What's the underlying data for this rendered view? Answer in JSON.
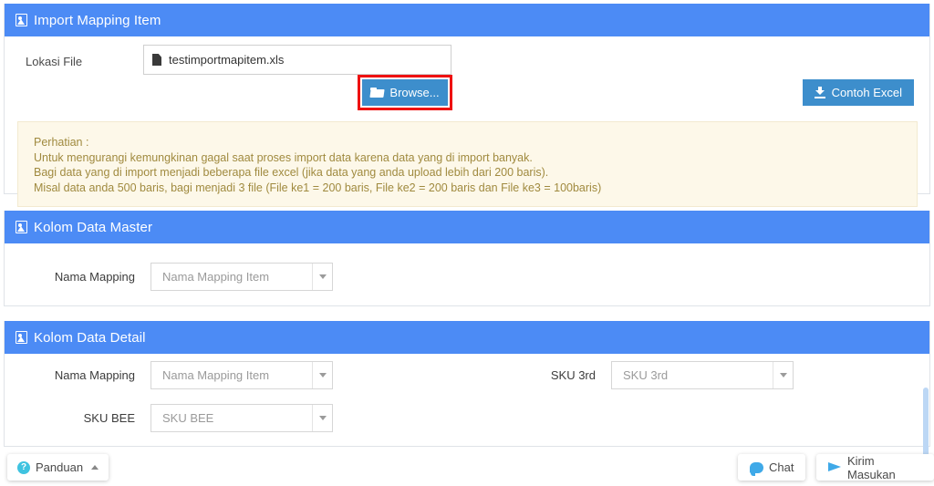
{
  "colors": {
    "header_blue": "#4c8bf5",
    "button_blue": "#3d8ecc",
    "warning_bg": "#fdf8e9",
    "warning_text": "#a08a3f",
    "highlight_red": "#ee1111",
    "accent_cyan": "#3fc3e0"
  },
  "import_section": {
    "title": "Import Mapping Item",
    "icon": "broken-image-icon",
    "file_label": "Lokasi File",
    "file_name": "testimportmapitem.xls",
    "file_icon": "document-icon",
    "browse_label": "Browse...",
    "browse_icon": "folder-icon",
    "contoh_label": "Contoh Excel",
    "contoh_icon": "download-icon",
    "warning": {
      "heading": "Perhatian :",
      "lines": [
        "Untuk mengurangi kemungkinan gagal saat proses import data karena data yang di import banyak.",
        "Bagi data yang di import menjadi beberapa file excel (jika data yang anda upload lebih dari 200 baris).",
        "Misal data anda 500 baris, bagi menjadi 3 file (File ke1 = 200 baris, File ke2 = 200 baris dan File ke3 = 100baris)"
      ]
    }
  },
  "master_section": {
    "title": "Kolom Data Master",
    "icon": "broken-image-icon",
    "fields": [
      {
        "label": "Nama Mapping",
        "placeholder": "Nama Mapping Item",
        "value": ""
      }
    ]
  },
  "detail_section": {
    "title": "Kolom Data Detail",
    "icon": "broken-image-icon",
    "fields_left": [
      {
        "label": "Nama Mapping",
        "placeholder": "Nama Mapping Item",
        "value": ""
      },
      {
        "label": "SKU BEE",
        "placeholder": "SKU BEE",
        "value": ""
      }
    ],
    "fields_right": [
      {
        "label": "SKU 3rd",
        "placeholder": "SKU 3rd",
        "value": ""
      }
    ]
  },
  "footer": {
    "panduan_label": "Panduan",
    "panduan_icon": "question-circle-icon",
    "panduan_chevron": "chevron-up-icon",
    "chat_label": "Chat",
    "chat_icon": "chat-bubble-icon",
    "masukan_label": "Kirim Masukan",
    "masukan_icon": "paper-plane-icon"
  }
}
